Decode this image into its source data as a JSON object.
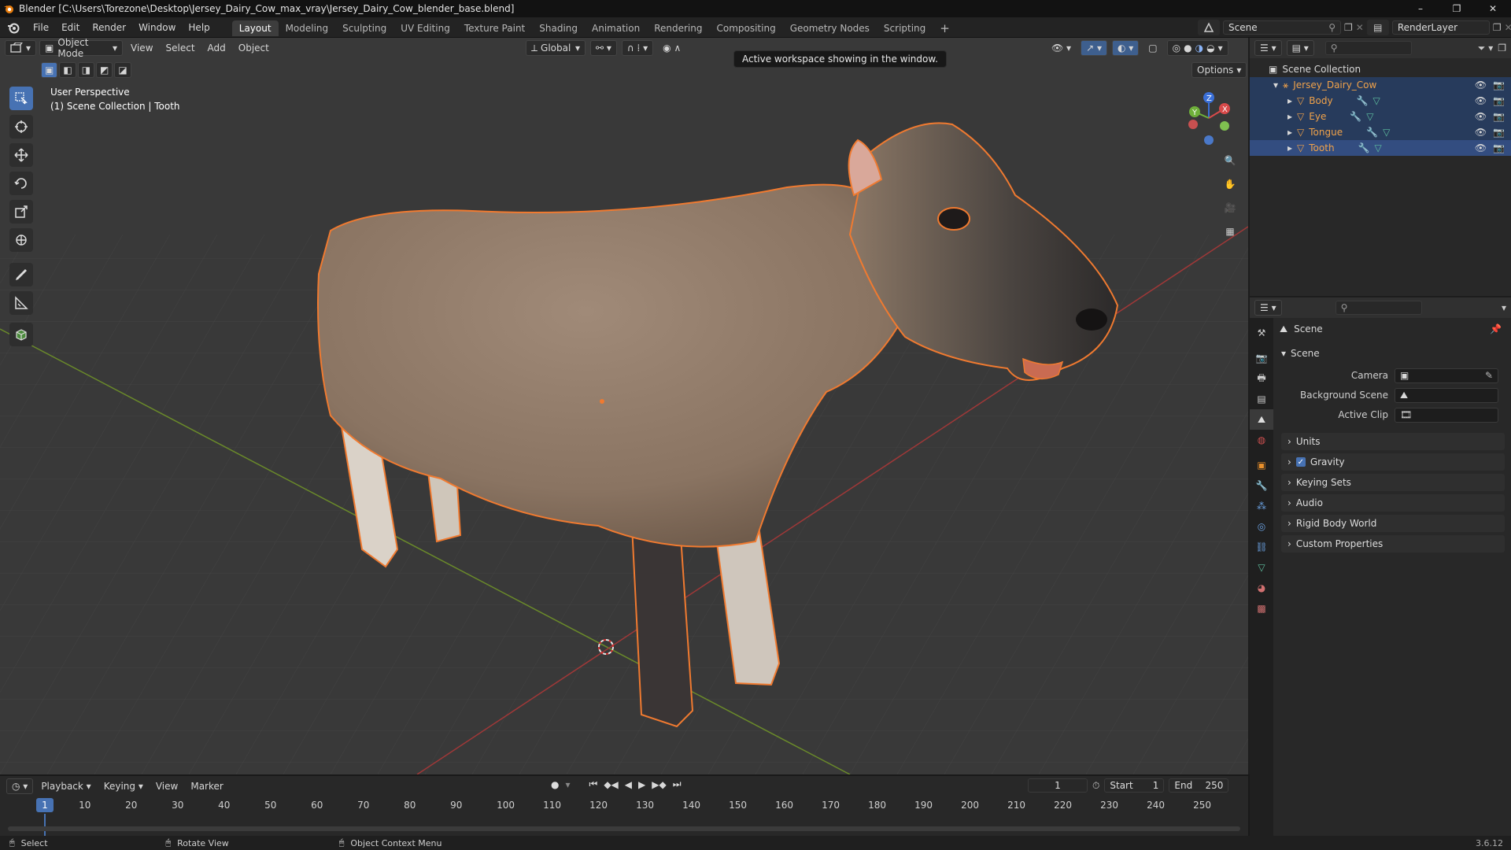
{
  "title_bar": {
    "title": "Blender [C:\\Users\\Torezone\\Desktop\\Jersey_Dairy_Cow_max_vray\\Jersey_Dairy_Cow_blender_base.blend]",
    "minimize": "–",
    "maximize": "❐",
    "close": "✕"
  },
  "menu": {
    "items": [
      "File",
      "Edit",
      "Render",
      "Window",
      "Help"
    ],
    "workspaces": [
      "Layout",
      "Modeling",
      "Sculpting",
      "UV Editing",
      "Texture Paint",
      "Shading",
      "Animation",
      "Rendering",
      "Compositing",
      "Geometry Nodes",
      "Scripting"
    ],
    "active_workspace": "Layout",
    "add_tab": "+",
    "scene_name": "Scene",
    "view_layer": "RenderLayer"
  },
  "viewport": {
    "mode": "Object Mode",
    "menus": [
      "View",
      "Select",
      "Add",
      "Object"
    ],
    "orientation": "Global",
    "options_label": "Options",
    "tooltip": "Active workspace showing in the window.",
    "perspective": "User Perspective",
    "collection_info": "(1) Scene Collection | Tooth",
    "accent_color": "#4772b3",
    "selection_color": "#f07a30"
  },
  "outliner": {
    "root": "Scene Collection",
    "collection": "Jersey_Dairy_Cow",
    "objects": [
      "Body",
      "Eye",
      "Tongue",
      "Tooth"
    ],
    "active_object": "Tooth"
  },
  "properties": {
    "context": "Scene",
    "panel_scene": "Scene",
    "camera_label": "Camera",
    "background_scene_label": "Background Scene",
    "active_clip_label": "Active Clip",
    "panels": [
      "Units",
      "Gravity",
      "Keying Sets",
      "Audio",
      "Rigid Body World",
      "Custom Properties"
    ],
    "gravity_checked": true
  },
  "timeline": {
    "menus": [
      "Playback",
      "Keying",
      "View",
      "Marker"
    ],
    "current_frame": "1",
    "start_label": "Start",
    "start": "1",
    "end_label": "End",
    "end": "250",
    "ticks": [
      "1",
      "10",
      "20",
      "30",
      "40",
      "50",
      "60",
      "70",
      "80",
      "90",
      "100",
      "110",
      "120",
      "130",
      "140",
      "150",
      "160",
      "170",
      "180",
      "190",
      "200",
      "210",
      "220",
      "230",
      "240",
      "250"
    ]
  },
  "status_bar": {
    "select": "Select",
    "rotate": "Rotate View",
    "context_menu": "Object Context Menu",
    "version": "3.6.12"
  }
}
